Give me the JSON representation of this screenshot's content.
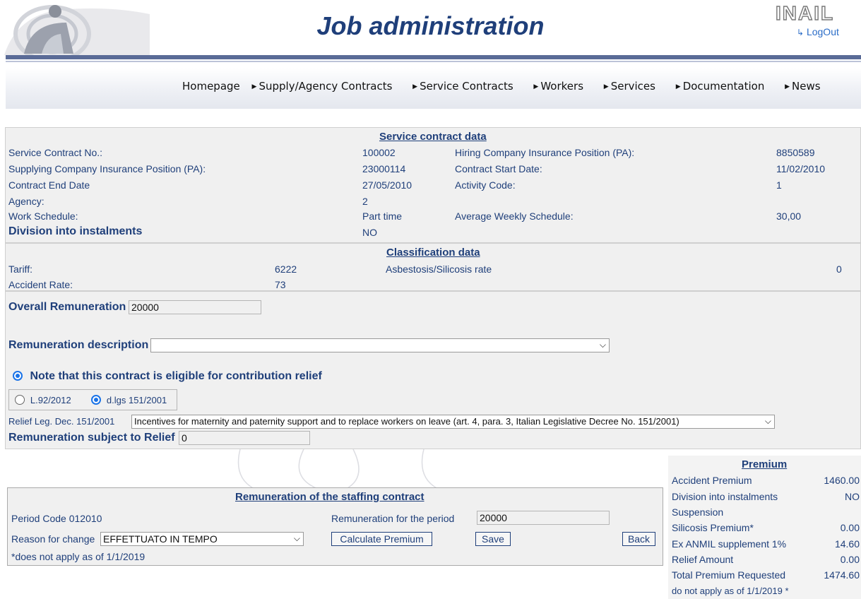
{
  "header": {
    "title": "Job administration",
    "brand": "INAIL",
    "logout_label": "LogOut"
  },
  "nav": [
    "Homepage",
    "Supply/Agency Contracts",
    "Service Contracts",
    "Workers",
    "Services",
    "Documentation",
    "News"
  ],
  "service_contract": {
    "title": "Service contract data",
    "contract_no_label": "Service Contract No.:",
    "contract_no": "100002",
    "hiring_pa_label": "Hiring Company Insurance Position (PA):",
    "hiring_pa": "8850589",
    "supplying_pa_label": "Supplying Company Insurance Position (PA):",
    "supplying_pa": "23000114",
    "start_date_label": "Contract Start Date:",
    "start_date": "11/02/2010",
    "end_date_label": "Contract End Date",
    "end_date": "27/05/2010",
    "activity_code_label": "Activity Code:",
    "activity_code": "1",
    "agency_label": "Agency:",
    "agency": "2",
    "work_schedule_label": "Work Schedule:",
    "work_schedule": "Part time",
    "avg_weekly_label": "Average Weekly Schedule:",
    "avg_weekly": "30,00",
    "instalments_label": "Division into instalments",
    "instalments": "NO"
  },
  "classification": {
    "title": "Classification data",
    "tariff_label": "Tariff:",
    "tariff": "6222",
    "asbestosis_label": "Asbestosis/Silicosis rate",
    "asbestosis": "0",
    "accident_rate_label": "Accident Rate:",
    "accident_rate": "73"
  },
  "remuneration": {
    "overall_label": "Overall Remuneration",
    "overall_value": "20000",
    "description_label": "Remuneration description",
    "description_value": "",
    "relief_note": "Note that this contract is eligible for contribution relief",
    "option_a": "L.92/2012",
    "option_b": "d.lgs 151/2001",
    "relief_leg_label": "Relief Leg. Dec. 151/2001",
    "relief_leg_value": "Incentives for maternity and paternity support and to replace workers on leave (art. 4, para. 3, Italian Legislative Decree No. 151/2001)",
    "subject_label": "Remuneration subject to Relief",
    "subject_value": "0"
  },
  "staffing": {
    "title": "Remuneration of the staffing contract",
    "period_code": "Period Code 012010",
    "period_rem_label": "Remuneration for the period",
    "period_rem_value": "20000",
    "reason_label": "Reason for change",
    "reason_value": "EFFETTUATO IN TEMPO",
    "calc_button": "Calculate Premium",
    "save_button": "Save",
    "back_button": "Back",
    "note": "*does not apply as of 1/1/2019"
  },
  "premium": {
    "title": "Premium",
    "rows": [
      {
        "label": "Accident Premium",
        "value": "1460.00"
      },
      {
        "label": "Division into instalments",
        "value": "NO"
      },
      {
        "label": "Suspension",
        "value": ""
      },
      {
        "label": "Silicosis Premium*",
        "value": "0.00"
      },
      {
        "label": "Ex ANMIL supplement 1%",
        "value": "14.60"
      },
      {
        "label": "Relief Amount",
        "value": "0.00"
      },
      {
        "label": "Total Premium Requested",
        "value": "1474.60"
      }
    ],
    "footer": "do not apply as of 1/1/2019 *"
  },
  "colors": {
    "navy": "#1f3f7a",
    "panel": "#f0f0f0",
    "accent": "#1a73e8"
  }
}
